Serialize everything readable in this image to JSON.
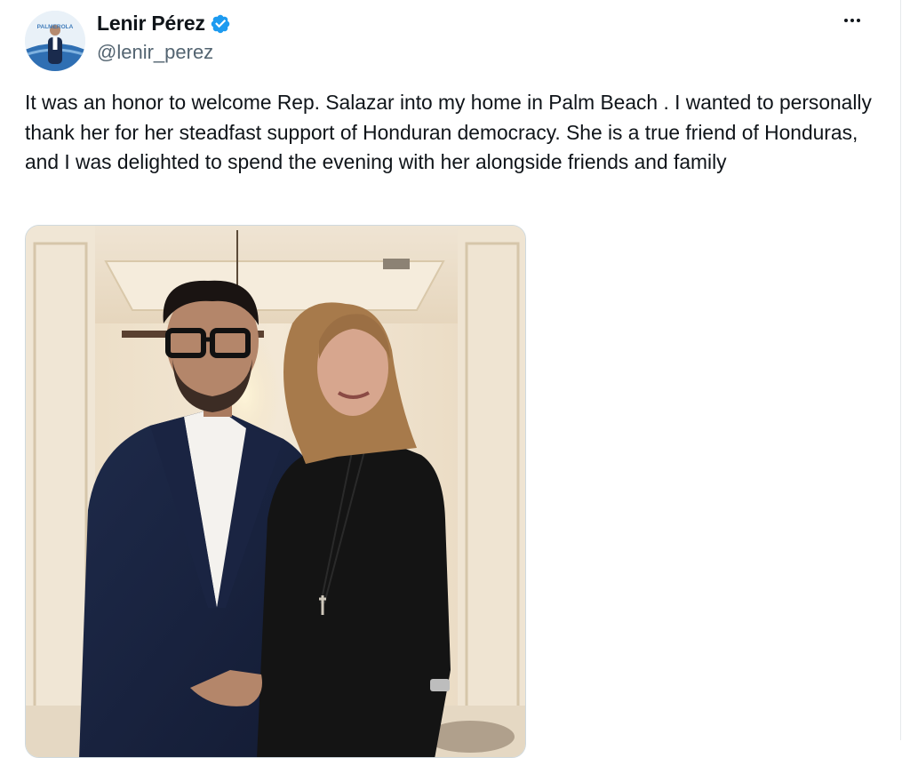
{
  "tweet": {
    "display_name": "Lenir Pérez",
    "handle": "@lenir_perez",
    "verified": true,
    "text": "It was an honor to welcome Rep. Salazar into my home in Palm Beach . I wanted to personally thank her for her steadfast support of Honduran democracy. She is a true friend of Honduras, and I was delighted to spend the evening with her alongside friends and family",
    "avatar_label": "PALMEROLA",
    "icons": {
      "verified": "verified-badge-icon",
      "more": "more-options-icon"
    },
    "colors": {
      "verified": "#1d9bf0",
      "handle": "#536471",
      "text": "#0f1419"
    }
  }
}
